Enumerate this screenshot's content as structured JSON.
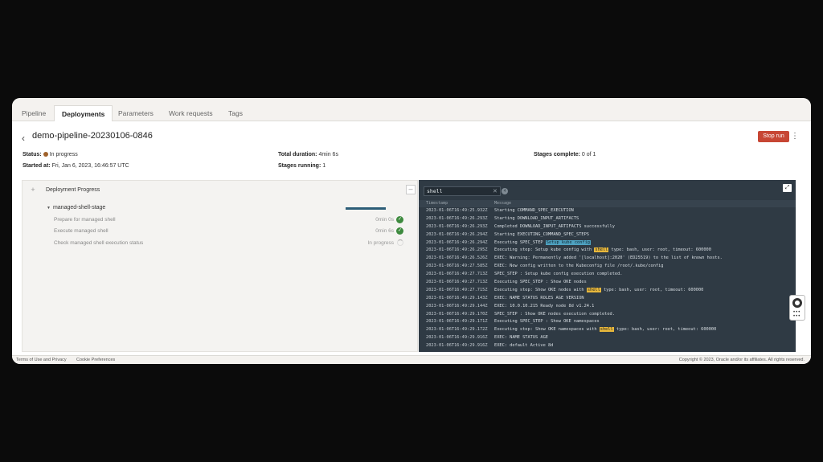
{
  "tabs": [
    "Pipeline",
    "Deployments",
    "Parameters",
    "Work requests",
    "Tags"
  ],
  "active_tab": "Deployments",
  "header": {
    "title": "demo-pipeline-20230106-0846",
    "stop_label": "Stop run",
    "status_label": "Status:",
    "status_value": "In progress",
    "started_label": "Started at:",
    "started_value": "Fri, Jan 6, 2023, 16:46:57 UTC",
    "duration_label": "Total duration:",
    "duration_value": "4min 6s",
    "stages_running_label": "Stages running:",
    "stages_running_value": "1",
    "stages_complete_label": "Stages complete:",
    "stages_complete_value": "0 of 1"
  },
  "progress": {
    "panel_title": "Deployment Progress",
    "stage_name": "managed-shell-stage",
    "steps": [
      {
        "name": "Prepare for managed shell",
        "time": "0min 0s",
        "state": "done"
      },
      {
        "name": "Execute managed shell",
        "time": "0min 6s",
        "state": "done"
      },
      {
        "name": "Check managed shell execution status",
        "time": "In progress",
        "state": "running"
      }
    ]
  },
  "logs": {
    "search_value": "shell",
    "match_count": "4",
    "col_timestamp": "Timestamp",
    "col_message": "Message",
    "rows": [
      {
        "ts": "2023-01-06T16:49:25.932Z",
        "msg": "Starting COMMAND_SPEC_EXECUTION"
      },
      {
        "ts": "2023-01-06T16:49:26.293Z",
        "msg": "Starting DOWNLOAD_INPUT_ARTIFACTS"
      },
      {
        "ts": "2023-01-06T16:49:26.293Z",
        "msg": "Completed DOWNLOAD_INPUT_ARTIFACTS successfully"
      },
      {
        "ts": "2023-01-06T16:49:26.294Z",
        "msg": "Starting EXECUTING_COMMAND_SPEC_STEPS"
      },
      {
        "ts": "2023-01-06T16:49:26.294Z",
        "pre": "Executing SPEC_STEP ",
        "hl": "Setup kube config",
        "hl_type": "blue",
        "post": ""
      },
      {
        "ts": "2023-01-06T16:49:26.295Z",
        "pre": "Executing step: Setup kube config with ",
        "hl": "shell",
        "hl_type": "yellow",
        "post": " type: bash, user: root, timeout: 600000"
      },
      {
        "ts": "2023-01-06T16:49:26.526Z",
        "msg": "EXEC: Warning: Permanently added '[localhost]:2020' (ED25519) to the list of known hosts."
      },
      {
        "ts": "2023-01-06T16:49:27.585Z",
        "msg": "EXEC: New config written to the Kubeconfig file /root/.kube/config"
      },
      {
        "ts": "2023-01-06T16:49:27.713Z",
        "msg": "SPEC_STEP : Setup kube config execution completed."
      },
      {
        "ts": "2023-01-06T16:49:27.713Z",
        "msg": "Executing SPEC_STEP : Show OKE nodes"
      },
      {
        "ts": "2023-01-06T16:49:27.715Z",
        "pre": "Executing step: Show OKE nodes with ",
        "hl": "shell",
        "hl_type": "yellow",
        "post": " type: bash, user: root, timeout: 600000"
      },
      {
        "ts": "2023-01-06T16:49:29.143Z",
        "msg": "EXEC: NAME         STATUS   ROLES   AGE   VERSION"
      },
      {
        "ts": "2023-01-06T16:49:29.144Z",
        "msg": "EXEC: 10.0.10.215   Ready    node    8d    v1.24.1"
      },
      {
        "ts": "2023-01-06T16:49:29.170Z",
        "msg": "SPEC_STEP : Show OKE nodes execution completed."
      },
      {
        "ts": "2023-01-06T16:49:29.171Z",
        "msg": "Executing SPEC_STEP : Show OKE namespaces"
      },
      {
        "ts": "2023-01-06T16:49:29.172Z",
        "pre": "Executing step: Show OKE namespaces with ",
        "hl": "shell",
        "hl_type": "yellow",
        "post": " type: bash, user: root, timeout: 600000"
      },
      {
        "ts": "2023-01-06T16:49:29.916Z",
        "msg": "EXEC: NAME                       STATUS   AGE"
      },
      {
        "ts": "2023-01-06T16:49:29.916Z",
        "msg": "EXEC: default                    Active   8d"
      }
    ]
  },
  "footer": {
    "terms": "Terms of Use and Privacy",
    "cookies": "Cookie Preferences",
    "copyright": "Copyright © 2023, Oracle and/or its affiliates. All rights reserved."
  },
  "colors": {
    "stop_button": "#c74634",
    "log_background": "#2f3a44",
    "success_check": "#3d8a3e",
    "highlight_yellow": "#e8b83c",
    "highlight_blue": "#4fa3c2"
  }
}
